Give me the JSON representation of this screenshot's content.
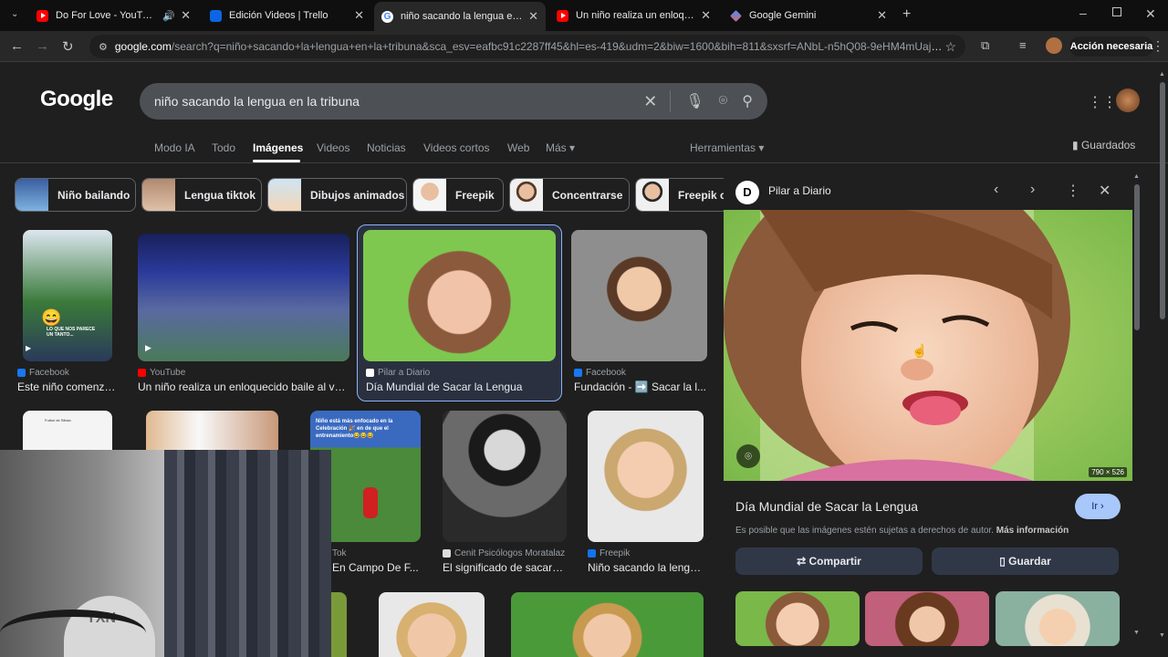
{
  "browser": {
    "tabs": [
      {
        "title": "Do For Love - YouTube",
        "favicon": "youtube-icon",
        "audio": true
      },
      {
        "title": "Edición Videos | Trello",
        "favicon": "trello-icon"
      },
      {
        "title": "niño sacando la lengua en la tr",
        "favicon": "google-icon",
        "active": true
      },
      {
        "title": "Un niño realiza un enloquecido",
        "favicon": "youtube-icon"
      },
      {
        "title": "Google Gemini",
        "favicon": "gemini-icon"
      }
    ],
    "url_host": "google.com",
    "url_rest": "/search?q=niño+sacando+la+lengua+en+la+tribuna&sca_esv=eafbc91c2287ff45&hl=es-419&udm=2&biw=1600&bih=811&sxsrf=ANbL-n5hQ08-9eHM4mUajKf6u7qJ...",
    "action_label": "Acción necesaria"
  },
  "search": {
    "logo": "Google",
    "query": "niño sacando la lengua en la tribuna"
  },
  "nav_tabs": [
    "Modo IA",
    "Todo",
    "Imágenes",
    "Videos",
    "Noticias",
    "Videos cortos",
    "Web",
    "Más"
  ],
  "tools_label": "Herramientas",
  "saved_label": "Guardados",
  "chips": [
    "Niño bailando",
    "Lengua tiktok",
    "Dibujos animados",
    "Freepik",
    "Concentrarse",
    "Freepik c"
  ],
  "results_row1": [
    {
      "source": "Facebook",
      "title": "Este niño comenzó..."
    },
    {
      "source": "YouTube",
      "title": "Un niño realiza un enloquecido baile al ve..."
    },
    {
      "source": "Pilar a Diario",
      "title": "Día Mundial de Sacar la Lengua"
    },
    {
      "source": "Facebook",
      "title": "Fundación - ➡️ Sacar la l..."
    }
  ],
  "results_row2": [
    {
      "source": "Tok",
      "title": "En Campo De F..."
    },
    {
      "source": "Cenit Psicólogos Moratalaz",
      "title": "El significado de sacar l..."
    },
    {
      "source": "Freepik",
      "title": "Niño sacando la lengu..."
    }
  ],
  "thumb_texts": {
    "fb_caption": "LO QUE NOS PARECE UN TANTO...",
    "celebracion": "Niño está más enfocado en la Celebración 🎉 en de que el entrenamiento😂😂😂",
    "doc_title": "Futbol de Siltalo"
  },
  "panel": {
    "badge": "D",
    "source": "Pilar a Diario",
    "title": "Día Mundial de Sacar la Lengua",
    "visit": "Ir",
    "copyright": "Es posible que las imágenes estén sujetas a derechos de autor.",
    "more_info": "Más información",
    "share": "Compartir",
    "save": "Guardar",
    "dims": "790 × 526"
  },
  "webcam": {
    "watermark": "TXN"
  },
  "colors": {
    "accent": "#8ab4f8",
    "button_bg": "#303848",
    "visit_bg": "#a8c7fa"
  }
}
